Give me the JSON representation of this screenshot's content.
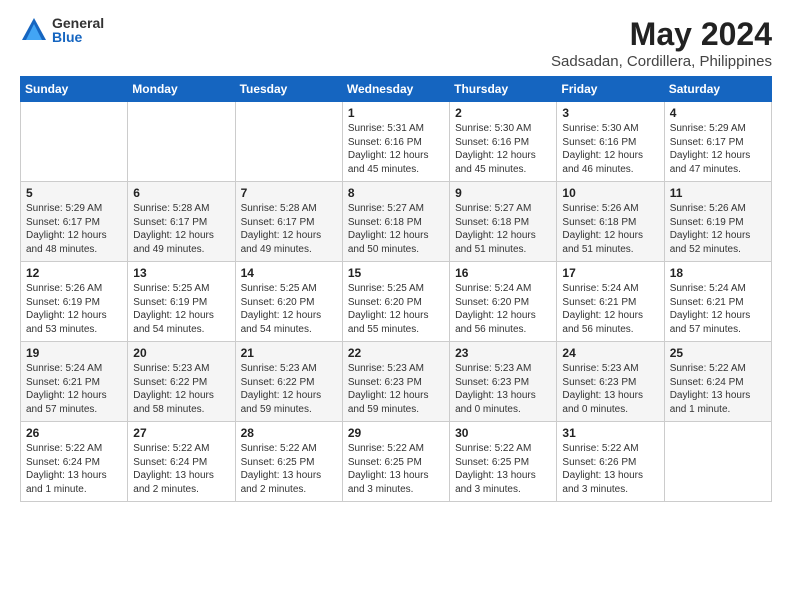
{
  "logo": {
    "general": "General",
    "blue": "Blue"
  },
  "title": "May 2024",
  "subtitle": "Sadsadan, Cordillera, Philippines",
  "days": [
    "Sunday",
    "Monday",
    "Tuesday",
    "Wednesday",
    "Thursday",
    "Friday",
    "Saturday"
  ],
  "weeks": [
    [
      {
        "day": "",
        "content": ""
      },
      {
        "day": "",
        "content": ""
      },
      {
        "day": "",
        "content": ""
      },
      {
        "day": "1",
        "content": "Sunrise: 5:31 AM\nSunset: 6:16 PM\nDaylight: 12 hours\nand 45 minutes."
      },
      {
        "day": "2",
        "content": "Sunrise: 5:30 AM\nSunset: 6:16 PM\nDaylight: 12 hours\nand 45 minutes."
      },
      {
        "day": "3",
        "content": "Sunrise: 5:30 AM\nSunset: 6:16 PM\nDaylight: 12 hours\nand 46 minutes."
      },
      {
        "day": "4",
        "content": "Sunrise: 5:29 AM\nSunset: 6:17 PM\nDaylight: 12 hours\nand 47 minutes."
      }
    ],
    [
      {
        "day": "5",
        "content": "Sunrise: 5:29 AM\nSunset: 6:17 PM\nDaylight: 12 hours\nand 48 minutes."
      },
      {
        "day": "6",
        "content": "Sunrise: 5:28 AM\nSunset: 6:17 PM\nDaylight: 12 hours\nand 49 minutes."
      },
      {
        "day": "7",
        "content": "Sunrise: 5:28 AM\nSunset: 6:17 PM\nDaylight: 12 hours\nand 49 minutes."
      },
      {
        "day": "8",
        "content": "Sunrise: 5:27 AM\nSunset: 6:18 PM\nDaylight: 12 hours\nand 50 minutes."
      },
      {
        "day": "9",
        "content": "Sunrise: 5:27 AM\nSunset: 6:18 PM\nDaylight: 12 hours\nand 51 minutes."
      },
      {
        "day": "10",
        "content": "Sunrise: 5:26 AM\nSunset: 6:18 PM\nDaylight: 12 hours\nand 51 minutes."
      },
      {
        "day": "11",
        "content": "Sunrise: 5:26 AM\nSunset: 6:19 PM\nDaylight: 12 hours\nand 52 minutes."
      }
    ],
    [
      {
        "day": "12",
        "content": "Sunrise: 5:26 AM\nSunset: 6:19 PM\nDaylight: 12 hours\nand 53 minutes."
      },
      {
        "day": "13",
        "content": "Sunrise: 5:25 AM\nSunset: 6:19 PM\nDaylight: 12 hours\nand 54 minutes."
      },
      {
        "day": "14",
        "content": "Sunrise: 5:25 AM\nSunset: 6:20 PM\nDaylight: 12 hours\nand 54 minutes."
      },
      {
        "day": "15",
        "content": "Sunrise: 5:25 AM\nSunset: 6:20 PM\nDaylight: 12 hours\nand 55 minutes."
      },
      {
        "day": "16",
        "content": "Sunrise: 5:24 AM\nSunset: 6:20 PM\nDaylight: 12 hours\nand 56 minutes."
      },
      {
        "day": "17",
        "content": "Sunrise: 5:24 AM\nSunset: 6:21 PM\nDaylight: 12 hours\nand 56 minutes."
      },
      {
        "day": "18",
        "content": "Sunrise: 5:24 AM\nSunset: 6:21 PM\nDaylight: 12 hours\nand 57 minutes."
      }
    ],
    [
      {
        "day": "19",
        "content": "Sunrise: 5:24 AM\nSunset: 6:21 PM\nDaylight: 12 hours\nand 57 minutes."
      },
      {
        "day": "20",
        "content": "Sunrise: 5:23 AM\nSunset: 6:22 PM\nDaylight: 12 hours\nand 58 minutes."
      },
      {
        "day": "21",
        "content": "Sunrise: 5:23 AM\nSunset: 6:22 PM\nDaylight: 12 hours\nand 59 minutes."
      },
      {
        "day": "22",
        "content": "Sunrise: 5:23 AM\nSunset: 6:23 PM\nDaylight: 12 hours\nand 59 minutes."
      },
      {
        "day": "23",
        "content": "Sunrise: 5:23 AM\nSunset: 6:23 PM\nDaylight: 13 hours\nand 0 minutes."
      },
      {
        "day": "24",
        "content": "Sunrise: 5:23 AM\nSunset: 6:23 PM\nDaylight: 13 hours\nand 0 minutes."
      },
      {
        "day": "25",
        "content": "Sunrise: 5:22 AM\nSunset: 6:24 PM\nDaylight: 13 hours\nand 1 minute."
      }
    ],
    [
      {
        "day": "26",
        "content": "Sunrise: 5:22 AM\nSunset: 6:24 PM\nDaylight: 13 hours\nand 1 minute."
      },
      {
        "day": "27",
        "content": "Sunrise: 5:22 AM\nSunset: 6:24 PM\nDaylight: 13 hours\nand 2 minutes."
      },
      {
        "day": "28",
        "content": "Sunrise: 5:22 AM\nSunset: 6:25 PM\nDaylight: 13 hours\nand 2 minutes."
      },
      {
        "day": "29",
        "content": "Sunrise: 5:22 AM\nSunset: 6:25 PM\nDaylight: 13 hours\nand 3 minutes."
      },
      {
        "day": "30",
        "content": "Sunrise: 5:22 AM\nSunset: 6:25 PM\nDaylight: 13 hours\nand 3 minutes."
      },
      {
        "day": "31",
        "content": "Sunrise: 5:22 AM\nSunset: 6:26 PM\nDaylight: 13 hours\nand 3 minutes."
      },
      {
        "day": "",
        "content": ""
      }
    ]
  ]
}
